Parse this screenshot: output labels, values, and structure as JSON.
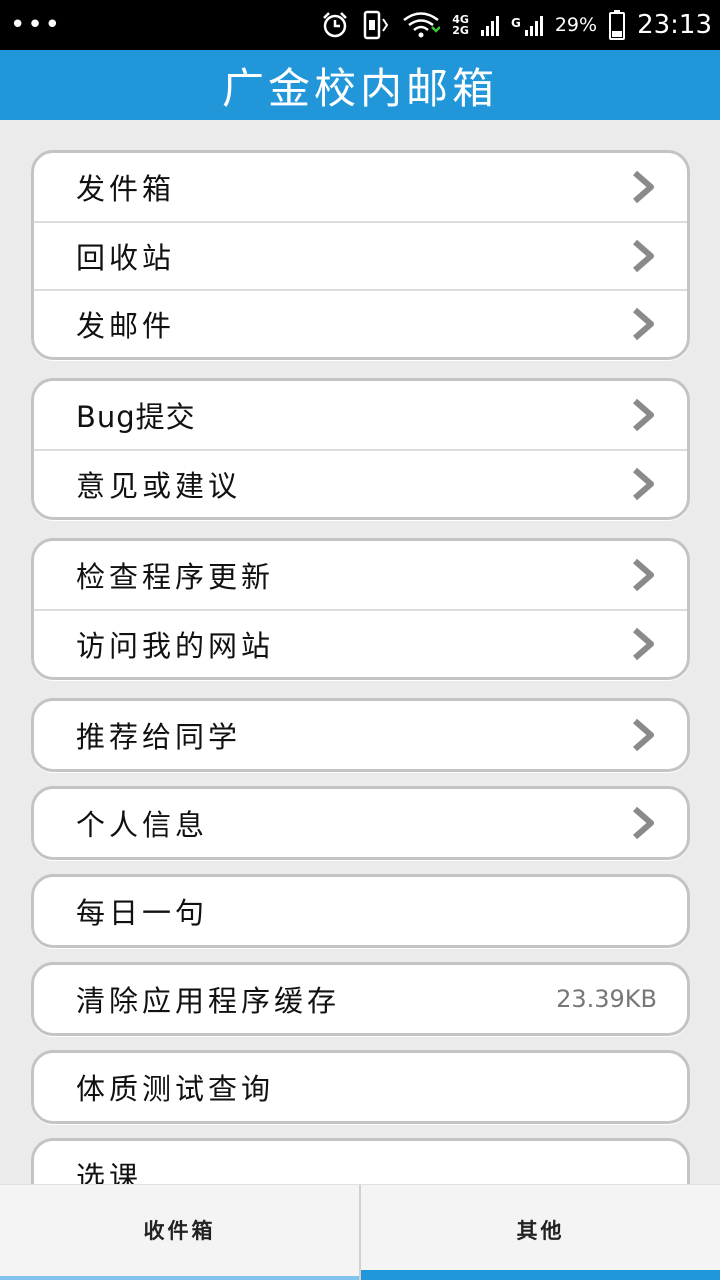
{
  "status_bar": {
    "dots": "•••",
    "net_top": "4G",
    "net_bottom": "2G",
    "g_label": "G",
    "battery": "29%",
    "time": "23:13",
    "icons": [
      "alarm-icon",
      "vibrate-icon",
      "wifi-icon",
      "signal-icon",
      "battery-icon"
    ]
  },
  "header": {
    "title": "广金校内邮箱"
  },
  "groups": [
    {
      "items": [
        {
          "label": "发件箱"
        },
        {
          "label": "回收站"
        },
        {
          "label": "发邮件"
        }
      ]
    },
    {
      "items": [
        {
          "label": "Bug提交"
        },
        {
          "label": "意见或建议"
        }
      ]
    },
    {
      "items": [
        {
          "label": "检查程序更新"
        },
        {
          "label": "访问我的网站"
        }
      ]
    },
    {
      "items": [
        {
          "label": "推荐给同学"
        }
      ]
    },
    {
      "items": [
        {
          "label": "个人信息"
        }
      ]
    },
    {
      "items": [
        {
          "label": "每日一句"
        }
      ]
    },
    {
      "items": [
        {
          "label": "清除应用程序缓存",
          "value": "23.39KB"
        }
      ]
    },
    {
      "items": [
        {
          "label": "体质测试查询"
        }
      ]
    },
    {
      "items": [
        {
          "label": "选课"
        }
      ]
    }
  ],
  "tabs": [
    {
      "label": "收件箱"
    },
    {
      "label": "其他"
    }
  ],
  "colors": {
    "accent": "#2196d9",
    "chevron": "#8a8a8a",
    "background": "#ebebeb"
  }
}
